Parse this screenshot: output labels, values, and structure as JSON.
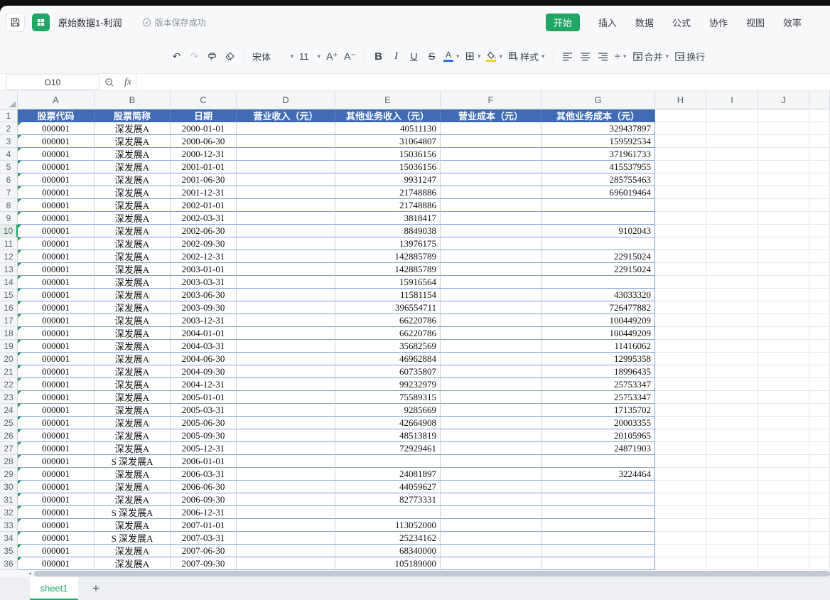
{
  "titlebar": {
    "title": "原始数据1-利润",
    "status": "版本保存成功",
    "tabs": [
      {
        "label": "开始",
        "active": true
      },
      {
        "label": "插入",
        "active": false
      },
      {
        "label": "数据",
        "active": false
      },
      {
        "label": "公式",
        "active": false
      },
      {
        "label": "协作",
        "active": false
      },
      {
        "label": "视图",
        "active": false
      },
      {
        "label": "效率",
        "active": false
      }
    ]
  },
  "toolbar": {
    "font_name": "宋体",
    "font_size": "11",
    "bold_label": "B",
    "italic_label": "I",
    "underline_label": "U",
    "strikethrough_label": "S",
    "font_color_label": "A",
    "style_label": "样式",
    "merge_label": "合并",
    "wrap_label": "换行"
  },
  "formula_bar": {
    "name_box": "O10",
    "fx_label": "fx",
    "formula_value": ""
  },
  "grid": {
    "column_letters": [
      "A",
      "B",
      "C",
      "D",
      "E",
      "F",
      "G",
      "H",
      "I",
      "J"
    ],
    "header_row": [
      "股票代码",
      "股票简称",
      "日期",
      "营业收入（元）",
      "其他业务收入（元）",
      "营业成本（元）",
      "其他业务成本（元）"
    ],
    "selected_row": 10,
    "rows": [
      {
        "n": 2,
        "code": "000001",
        "name": "深发展A",
        "date": "2000-01-01",
        "revenue": "",
        "other_income": "40511130",
        "cost": "",
        "other_cost": "329437897"
      },
      {
        "n": 3,
        "code": "000001",
        "name": "深发展A",
        "date": "2000-06-30",
        "revenue": "",
        "other_income": "31064807",
        "cost": "",
        "other_cost": "159592534"
      },
      {
        "n": 4,
        "code": "000001",
        "name": "深发展A",
        "date": "2000-12-31",
        "revenue": "",
        "other_income": "15036156",
        "cost": "",
        "other_cost": "371961733"
      },
      {
        "n": 5,
        "code": "000001",
        "name": "深发展A",
        "date": "2001-01-01",
        "revenue": "",
        "other_income": "15036156",
        "cost": "",
        "other_cost": "415537955"
      },
      {
        "n": 6,
        "code": "000001",
        "name": "深发展A",
        "date": "2001-06-30",
        "revenue": "",
        "other_income": "9931247",
        "cost": "",
        "other_cost": "285755463"
      },
      {
        "n": 7,
        "code": "000001",
        "name": "深发展A",
        "date": "2001-12-31",
        "revenue": "",
        "other_income": "21748886",
        "cost": "",
        "other_cost": "696019464"
      },
      {
        "n": 8,
        "code": "000001",
        "name": "深发展A",
        "date": "2002-01-01",
        "revenue": "",
        "other_income": "21748886",
        "cost": "",
        "other_cost": ""
      },
      {
        "n": 9,
        "code": "000001",
        "name": "深发展A",
        "date": "2002-03-31",
        "revenue": "",
        "other_income": "3818417",
        "cost": "",
        "other_cost": ""
      },
      {
        "n": 10,
        "code": "000001",
        "name": "深发展A",
        "date": "2002-06-30",
        "revenue": "",
        "other_income": "8849038",
        "cost": "",
        "other_cost": "9102043"
      },
      {
        "n": 11,
        "code": "000001",
        "name": "深发展A",
        "date": "2002-09-30",
        "revenue": "",
        "other_income": "13976175",
        "cost": "",
        "other_cost": ""
      },
      {
        "n": 12,
        "code": "000001",
        "name": "深发展A",
        "date": "2002-12-31",
        "revenue": "",
        "other_income": "142885789",
        "cost": "",
        "other_cost": "22915024"
      },
      {
        "n": 13,
        "code": "000001",
        "name": "深发展A",
        "date": "2003-01-01",
        "revenue": "",
        "other_income": "142885789",
        "cost": "",
        "other_cost": "22915024"
      },
      {
        "n": 14,
        "code": "000001",
        "name": "深发展A",
        "date": "2003-03-31",
        "revenue": "",
        "other_income": "15916564",
        "cost": "",
        "other_cost": ""
      },
      {
        "n": 15,
        "code": "000001",
        "name": "深发展A",
        "date": "2003-06-30",
        "revenue": "",
        "other_income": "11581154",
        "cost": "",
        "other_cost": "43033320"
      },
      {
        "n": 16,
        "code": "000001",
        "name": "深发展A",
        "date": "2003-09-30",
        "revenue": "",
        "other_income": "396554711",
        "cost": "",
        "other_cost": "726477882"
      },
      {
        "n": 17,
        "code": "000001",
        "name": "深发展A",
        "date": "2003-12-31",
        "revenue": "",
        "other_income": "66220786",
        "cost": "",
        "other_cost": "100449209"
      },
      {
        "n": 18,
        "code": "000001",
        "name": "深发展A",
        "date": "2004-01-01",
        "revenue": "",
        "other_income": "66220786",
        "cost": "",
        "other_cost": "100449209"
      },
      {
        "n": 19,
        "code": "000001",
        "name": "深发展A",
        "date": "2004-03-31",
        "revenue": "",
        "other_income": "35682569",
        "cost": "",
        "other_cost": "11416062"
      },
      {
        "n": 20,
        "code": "000001",
        "name": "深发展A",
        "date": "2004-06-30",
        "revenue": "",
        "other_income": "46962884",
        "cost": "",
        "other_cost": "12995358"
      },
      {
        "n": 21,
        "code": "000001",
        "name": "深发展A",
        "date": "2004-09-30",
        "revenue": "",
        "other_income": "60735807",
        "cost": "",
        "other_cost": "18996435"
      },
      {
        "n": 22,
        "code": "000001",
        "name": "深发展A",
        "date": "2004-12-31",
        "revenue": "",
        "other_income": "99232979",
        "cost": "",
        "other_cost": "25753347"
      },
      {
        "n": 23,
        "code": "000001",
        "name": "深发展A",
        "date": "2005-01-01",
        "revenue": "",
        "other_income": "75589315",
        "cost": "",
        "other_cost": "25753347"
      },
      {
        "n": 24,
        "code": "000001",
        "name": "深发展A",
        "date": "2005-03-31",
        "revenue": "",
        "other_income": "9285669",
        "cost": "",
        "other_cost": "17135702"
      },
      {
        "n": 25,
        "code": "000001",
        "name": "深发展A",
        "date": "2005-06-30",
        "revenue": "",
        "other_income": "42664908",
        "cost": "",
        "other_cost": "20003355"
      },
      {
        "n": 26,
        "code": "000001",
        "name": "深发展A",
        "date": "2005-09-30",
        "revenue": "",
        "other_income": "48513819",
        "cost": "",
        "other_cost": "20105965"
      },
      {
        "n": 27,
        "code": "000001",
        "name": "深发展A",
        "date": "2005-12-31",
        "revenue": "",
        "other_income": "72929461",
        "cost": "",
        "other_cost": "24871903"
      },
      {
        "n": 28,
        "code": "000001",
        "name": "S 深发展A",
        "date": "2006-01-01",
        "revenue": "",
        "other_income": "",
        "cost": "",
        "other_cost": ""
      },
      {
        "n": 29,
        "code": "000001",
        "name": "深发展A",
        "date": "2006-03-31",
        "revenue": "",
        "other_income": "24081897",
        "cost": "",
        "other_cost": "3224464"
      },
      {
        "n": 30,
        "code": "000001",
        "name": "深发展A",
        "date": "2006-06-30",
        "revenue": "",
        "other_income": "44059627",
        "cost": "",
        "other_cost": ""
      },
      {
        "n": 31,
        "code": "000001",
        "name": "深发展A",
        "date": "2006-09-30",
        "revenue": "",
        "other_income": "82773331",
        "cost": "",
        "other_cost": ""
      },
      {
        "n": 32,
        "code": "000001",
        "name": "S 深发展A",
        "date": "2006-12-31",
        "revenue": "",
        "other_income": "",
        "cost": "",
        "other_cost": ""
      },
      {
        "n": 33,
        "code": "000001",
        "name": "深发展A",
        "date": "2007-01-01",
        "revenue": "",
        "other_income": "113052000",
        "cost": "",
        "other_cost": ""
      },
      {
        "n": 34,
        "code": "000001",
        "name": "S 深发展A",
        "date": "2007-03-31",
        "revenue": "",
        "other_income": "25234162",
        "cost": "",
        "other_cost": ""
      },
      {
        "n": 35,
        "code": "000001",
        "name": "深发展A",
        "date": "2007-06-30",
        "revenue": "",
        "other_income": "68340000",
        "cost": "",
        "other_cost": ""
      },
      {
        "n": 36,
        "code": "000001",
        "name": "深发展A",
        "date": "2007-09-30",
        "revenue": "",
        "other_income": "105189000",
        "cost": "",
        "other_cost": ""
      }
    ]
  },
  "sheet_bar": {
    "active_tab": "sheet1",
    "add_label": "+"
  },
  "colors": {
    "accent_green": "#21a666",
    "header_blue": "#3f6cb5",
    "font_color_swatch": "#2f6fe4",
    "fill_color_swatch": "#f6d40e"
  }
}
